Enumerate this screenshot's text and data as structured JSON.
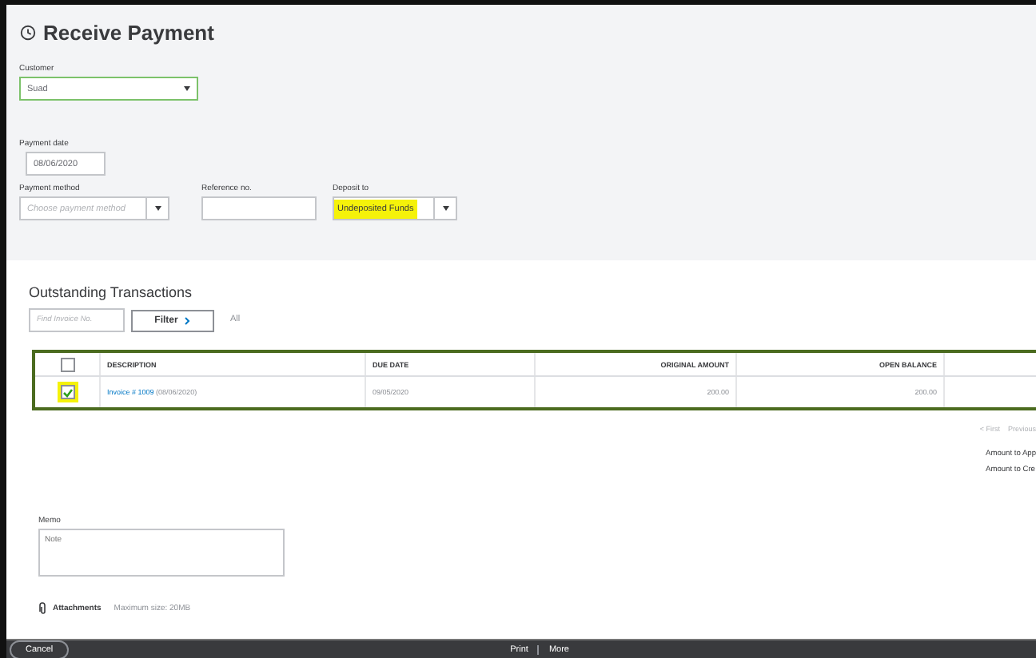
{
  "title": "Receive Payment",
  "customer": {
    "label": "Customer",
    "value": "Suad"
  },
  "payment_date": {
    "label": "Payment date",
    "value": "08/06/2020"
  },
  "payment_method": {
    "label": "Payment method",
    "placeholder": "Choose payment method"
  },
  "reference": {
    "label": "Reference no."
  },
  "deposit_to": {
    "label": "Deposit to",
    "value": "Undeposited Funds",
    "highlighted": true
  },
  "outstanding": {
    "title": "Outstanding Transactions",
    "search": {
      "placeholder": "Find Invoice No."
    },
    "filter_button": "Filter",
    "filter_value": "All"
  },
  "table": {
    "header_checked": false,
    "columns": [
      "DESCRIPTION",
      "DUE DATE",
      "ORIGINAL AMOUNT",
      "OPEN BALANCE"
    ],
    "rows": [
      {
        "checked": true,
        "highlighted": true,
        "link": "Invoice # 1009",
        "date": "(08/06/2020)",
        "due_date": "09/05/2020",
        "original_amount": "200.00",
        "open_balance": "200.00"
      }
    ]
  },
  "pager": [
    "< First",
    "Previous"
  ],
  "amounts": [
    "Amount to App",
    "Amount to Cre"
  ],
  "memo": {
    "label": "Memo",
    "placeholder": "Note"
  },
  "attachments": {
    "label": "Attachments",
    "note": "Maximum size: 20MB"
  },
  "footer": {
    "cancel": "Cancel",
    "actions": [
      "Print",
      "More"
    ]
  }
}
